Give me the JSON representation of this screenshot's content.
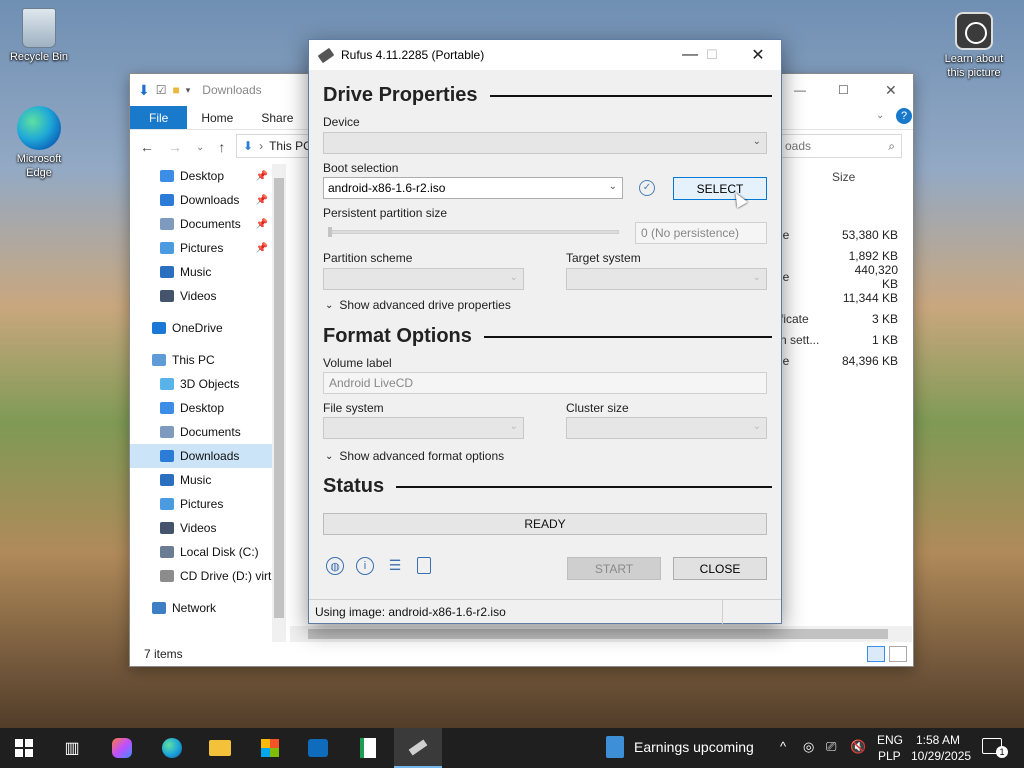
{
  "desktop": {
    "recycle_bin": "Recycle Bin",
    "edge_line1": "Microsoft",
    "edge_line2": "Edge",
    "learn_line1": "Learn about",
    "learn_line2": "this picture"
  },
  "explorer": {
    "title": "Downloads",
    "tabs": [
      "File",
      "Home",
      "Share"
    ],
    "address_crumb": "This PC",
    "search_placeholder": "oads",
    "column_size": "Size",
    "nav": [
      {
        "label": "Desktop",
        "pinned": true,
        "color": "#3a8ee6"
      },
      {
        "label": "Downloads",
        "pinned": true,
        "color": "#2b7cd6"
      },
      {
        "label": "Documents",
        "pinned": true,
        "color": "#7e9bbf"
      },
      {
        "label": "Pictures",
        "pinned": true,
        "color": "#4a9be0"
      },
      {
        "label": "Music",
        "pinned": false,
        "color": "#2b6fc1"
      },
      {
        "label": "Videos",
        "pinned": false,
        "color": "#44546a"
      },
      {
        "label": "OneDrive",
        "pinned": false,
        "color": "#1a78d6"
      },
      {
        "label": "This PC",
        "pinned": false,
        "color": "#5f9bd6"
      },
      {
        "label": "3D Objects",
        "pinned": false,
        "color": "#58b3e8"
      },
      {
        "label": "Desktop",
        "pinned": false,
        "color": "#3a8ee6"
      },
      {
        "label": "Documents",
        "pinned": false,
        "color": "#7e9bbf"
      },
      {
        "label": "Downloads",
        "pinned": false,
        "color": "#2b7cd6"
      },
      {
        "label": "Music",
        "pinned": false,
        "color": "#2b6fc1"
      },
      {
        "label": "Pictures",
        "pinned": false,
        "color": "#4a9be0"
      },
      {
        "label": "Videos",
        "pinned": false,
        "color": "#44546a"
      },
      {
        "label": "Local Disk (C:)",
        "pinned": false,
        "color": "#6a7d94"
      },
      {
        "label": "CD Drive (D:) virt",
        "pinned": false,
        "color": "#8c8c8c"
      },
      {
        "label": "Network",
        "pinned": false,
        "color": "#3c7fc4"
      }
    ],
    "rows": [
      {
        "type": "le",
        "size": "53,380 KB"
      },
      {
        "type": "",
        "size": "1,892 KB"
      },
      {
        "type": "le",
        "size": "440,320 KB"
      },
      {
        "type": "",
        "size": "11,344 KB"
      },
      {
        "type": "ficate",
        "size": "3 KB"
      },
      {
        "type": "n sett...",
        "size": "1 KB"
      },
      {
        "type": "le",
        "size": "84,396 KB"
      }
    ],
    "status": "7 items"
  },
  "rufus": {
    "title": "Rufus 4.11.2285 (Portable)",
    "drive_properties": "Drive Properties",
    "device_label": "Device",
    "device_value": "",
    "boot_selection_label": "Boot selection",
    "boot_selection_value": "android-x86-1.6-r2.iso",
    "select_button": "SELECT",
    "persistent_label": "Persistent partition size",
    "persistent_value": "0 (No persistence)",
    "partition_scheme_label": "Partition scheme",
    "target_system_label": "Target system",
    "show_adv_drive": "Show advanced drive properties",
    "format_options": "Format Options",
    "volume_label_label": "Volume label",
    "volume_label_value": "Android LiveCD",
    "file_system_label": "File system",
    "cluster_size_label": "Cluster size",
    "show_adv_format": "Show advanced format options",
    "status_heading": "Status",
    "status_value": "READY",
    "start_button": "START",
    "close_button": "CLOSE",
    "status_bar": "Using image: android-x86-1.6-r2.iso"
  },
  "taskbar": {
    "news": "Earnings upcoming",
    "lang1": "ENG",
    "lang2": "PLP",
    "time": "1:58 AM",
    "date": "10/29/2025",
    "notif_count": "1"
  }
}
